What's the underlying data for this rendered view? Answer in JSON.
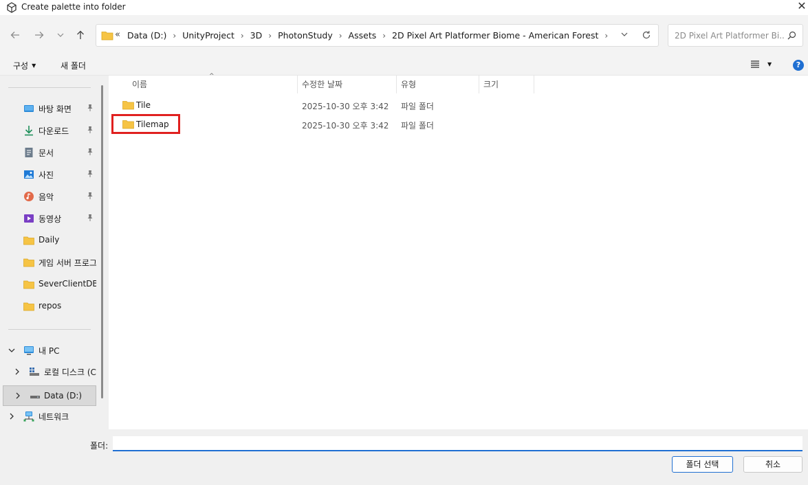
{
  "window": {
    "title": "Create palette into folder",
    "close_glyph": "✕"
  },
  "nav": {
    "back_icon": "back-arrow-icon",
    "forward_icon": "forward-arrow-icon",
    "recent_icon": "chevron-down-icon",
    "up_icon": "up-arrow-icon"
  },
  "address": {
    "overflow_glyph": "«",
    "separator": "›",
    "crumbs": [
      "Data (D:)",
      "UnityProject",
      "3D",
      "PhotonStudy",
      "Assets",
      "2D Pixel Art Platformer Biome - American Forest"
    ]
  },
  "search": {
    "placeholder": "2D Pixel Art Platformer Bi..."
  },
  "toolbar": {
    "organize_label": "구성",
    "new_folder_label": "새 폴더",
    "caret": "▼",
    "help_glyph": "?"
  },
  "sidebar": {
    "quick_access": [
      {
        "label": "바탕 화면",
        "icon": "desktop-icon",
        "pinned": true
      },
      {
        "label": "다운로드",
        "icon": "download-icon",
        "pinned": true
      },
      {
        "label": "문서",
        "icon": "document-icon",
        "pinned": true
      },
      {
        "label": "사진",
        "icon": "pictures-icon",
        "pinned": true
      },
      {
        "label": "음악",
        "icon": "music-icon",
        "pinned": true
      },
      {
        "label": "동영상",
        "icon": "videos-icon",
        "pinned": true
      },
      {
        "label": "Daily",
        "icon": "folder-icon",
        "pinned": false
      },
      {
        "label": "게임 서버 프로그",
        "icon": "folder-icon",
        "pinned": false
      },
      {
        "label": "SeverClientDB",
        "icon": "folder-icon",
        "pinned": false
      },
      {
        "label": "repos",
        "icon": "folder-icon",
        "pinned": false
      }
    ],
    "this_pc": {
      "label": "내 PC",
      "icon": "pc-icon",
      "expanded": true
    },
    "drives": [
      {
        "label": "로컬 디스크 (C",
        "icon": "drive-c-icon"
      },
      {
        "label": "Data (D:)",
        "icon": "drive-d-icon",
        "selected": true
      }
    ],
    "network": {
      "label": "네트워크",
      "icon": "network-icon"
    },
    "expand_glyph": "›",
    "collapse_glyph": "⌄"
  },
  "columns": {
    "name": "이름",
    "modified": "수정한 날짜",
    "type": "유형",
    "size": "크기",
    "sort_glyph": "^"
  },
  "files": [
    {
      "name": "Tile",
      "modified": "2025-10-30 오후 3:42",
      "type": "파일 폴더",
      "size": ""
    },
    {
      "name": "Tilemap",
      "modified": "2025-10-30 오후 3:42",
      "type": "파일 폴더",
      "size": "",
      "highlighted": true
    }
  ],
  "bottom": {
    "folder_label": "폴더:",
    "folder_value": "",
    "select_button": "폴더 선택",
    "cancel_button": "취소"
  },
  "colors": {
    "accent": "#1f6fd2",
    "highlight": "#e0201f",
    "folder": "#f6c445"
  }
}
